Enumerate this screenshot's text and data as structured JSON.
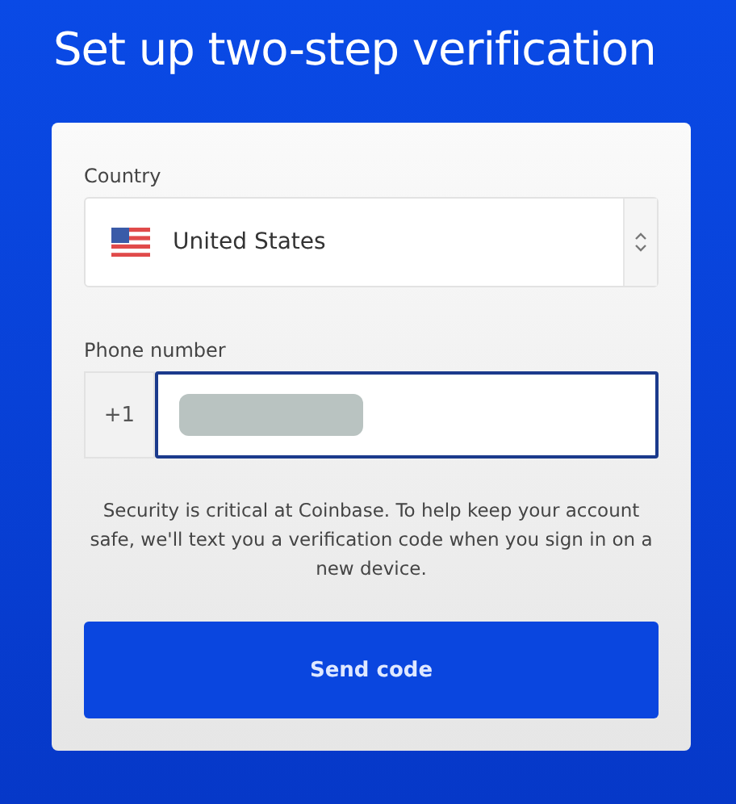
{
  "title": "Set up two-step verification",
  "country": {
    "label": "Country",
    "value": "United States"
  },
  "phone": {
    "label": "Phone number",
    "prefix": "+1",
    "focused": true,
    "redacted": true
  },
  "notice": "Security is critical at Coinbase. To help keep your account safe, we'll text you a verification code when you sign in on a new device.",
  "button": "Send code"
}
